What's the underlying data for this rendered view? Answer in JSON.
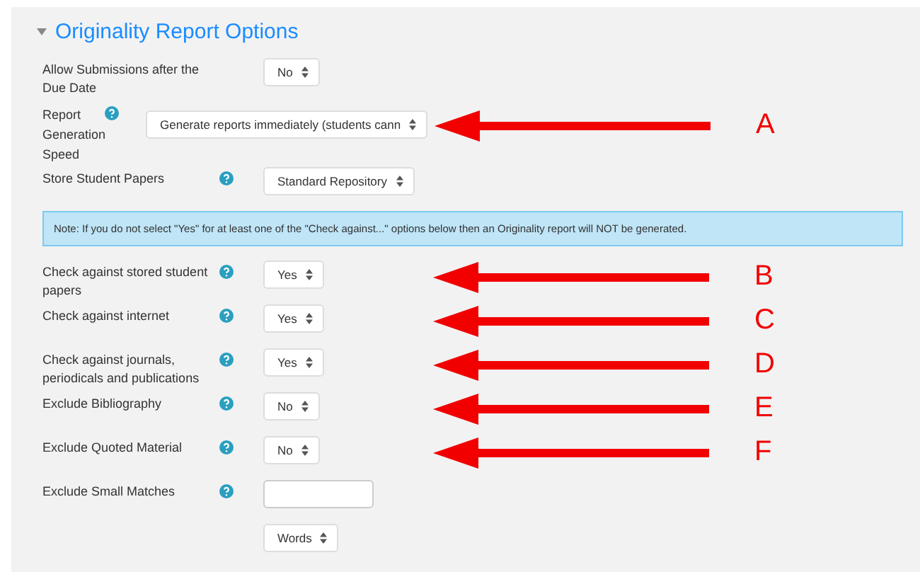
{
  "section": {
    "title": "Originality Report Options",
    "expanded": true
  },
  "rows": [
    {
      "label": "Allow Submissions after the Due Date",
      "help": false,
      "kind": "field",
      "control": {
        "kind": "select",
        "value": "No"
      }
    },
    {
      "label": "Report Generation Speed",
      "help": true,
      "kind": "wide",
      "control": {
        "kind": "select",
        "value": "Generate reports immediately (students cann"
      },
      "annotation": "A"
    },
    {
      "label": "Store Student Papers",
      "help": true,
      "kind": "field",
      "control": {
        "kind": "select",
        "value": "Standard Repository"
      }
    },
    {
      "kind": "note",
      "text": "Note: If you do not select \"Yes\" for at least one of the \"Check against...\" options below then an Originality report will NOT be generated."
    },
    {
      "label": "Check against stored student papers",
      "help": true,
      "kind": "field",
      "control": {
        "kind": "select",
        "value": "Yes"
      },
      "annotation": "B"
    },
    {
      "label": "Check against internet",
      "help": true,
      "kind": "field",
      "control": {
        "kind": "select",
        "value": "Yes"
      },
      "annotation": "C"
    },
    {
      "label": "Check against journals, periodicals and publications",
      "help": true,
      "kind": "field",
      "control": {
        "kind": "select",
        "value": "Yes"
      },
      "annotation": "D"
    },
    {
      "label": "Exclude Bibliography",
      "help": true,
      "kind": "field",
      "control": {
        "kind": "select",
        "value": "No"
      },
      "annotation": "E"
    },
    {
      "label": "Exclude Quoted Material",
      "help": true,
      "kind": "field",
      "control": {
        "kind": "select",
        "value": "No"
      },
      "annotation": "F"
    },
    {
      "label": "Exclude Small Matches",
      "help": true,
      "kind": "field",
      "control": {
        "kind": "text"
      }
    },
    {
      "kind": "field",
      "control": {
        "kind": "select",
        "value": "Words"
      }
    }
  ]
}
